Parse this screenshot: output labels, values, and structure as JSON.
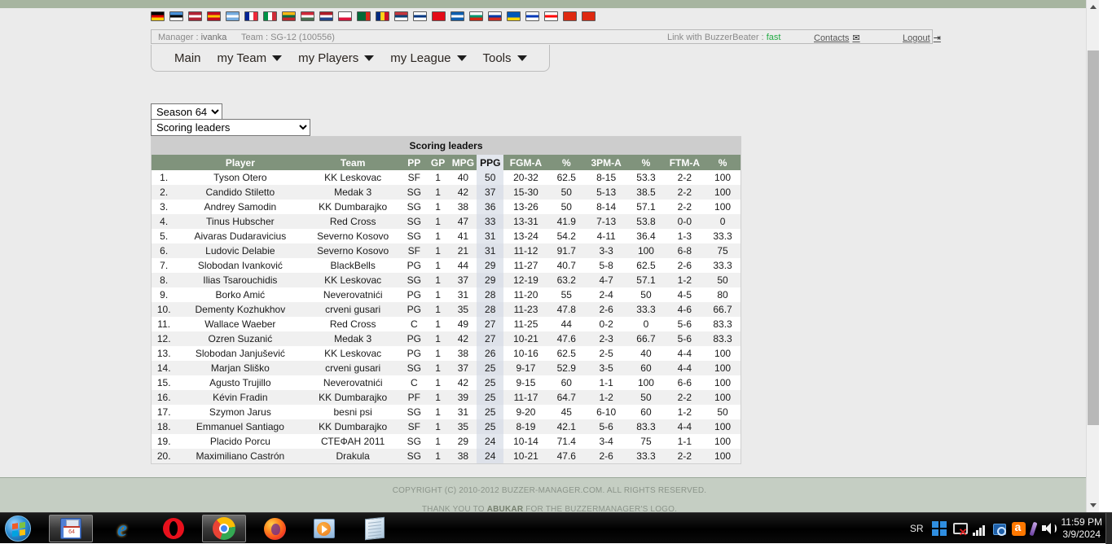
{
  "browser": {
    "scrollbar": {
      "up_arrow": "▲",
      "down_arrow": "▼"
    }
  },
  "header": {
    "flags": [
      {
        "name": "germany",
        "colors": [
          "#000000",
          "#dd0000",
          "#ffce00"
        ],
        "dir": "h"
      },
      {
        "name": "estonia",
        "colors": [
          "#4891d9",
          "#000000",
          "#ffffff"
        ],
        "dir": "h"
      },
      {
        "name": "usa",
        "colors": [
          "#b22234",
          "#ffffff",
          "#b22234"
        ],
        "dir": "h"
      },
      {
        "name": "spain",
        "colors": [
          "#c60b1e",
          "#ffc400",
          "#c60b1e"
        ],
        "dir": "h"
      },
      {
        "name": "argentina",
        "colors": [
          "#74acdf",
          "#ffffff",
          "#74acdf"
        ],
        "dir": "h"
      },
      {
        "name": "france",
        "colors": [
          "#002395",
          "#ffffff",
          "#ed2939"
        ],
        "dir": "v"
      },
      {
        "name": "italy",
        "colors": [
          "#009246",
          "#ffffff",
          "#ce2b37"
        ],
        "dir": "v"
      },
      {
        "name": "lithuania",
        "colors": [
          "#fdb913",
          "#006a44",
          "#c1272d"
        ],
        "dir": "h"
      },
      {
        "name": "hungary",
        "colors": [
          "#ce2939",
          "#ffffff",
          "#477050"
        ],
        "dir": "h"
      },
      {
        "name": "netherlands",
        "colors": [
          "#ae1c28",
          "#ffffff",
          "#21468b"
        ],
        "dir": "h"
      },
      {
        "name": "poland",
        "colors": [
          "#ffffff",
          "#ffffff",
          "#dc143c"
        ],
        "dir": "h"
      },
      {
        "name": "portugal",
        "colors": [
          "#046a38",
          "#046a38",
          "#da291c"
        ],
        "dir": "v"
      },
      {
        "name": "romania",
        "colors": [
          "#002b7f",
          "#fcd116",
          "#ce1126"
        ],
        "dir": "v"
      },
      {
        "name": "serbia",
        "colors": [
          "#c6363c",
          "#0c4076",
          "#ffffff"
        ],
        "dir": "h"
      },
      {
        "name": "finland",
        "colors": [
          "#ffffff",
          "#003580",
          "#ffffff"
        ],
        "dir": "h"
      },
      {
        "name": "turkey",
        "colors": [
          "#e30a17",
          "#e30a17",
          "#e30a17"
        ],
        "dir": "h"
      },
      {
        "name": "greece",
        "colors": [
          "#0d5eaf",
          "#ffffff",
          "#0d5eaf"
        ],
        "dir": "h"
      },
      {
        "name": "bulgaria",
        "colors": [
          "#ffffff",
          "#00966e",
          "#d62612"
        ],
        "dir": "h"
      },
      {
        "name": "russia",
        "colors": [
          "#ffffff",
          "#0039a6",
          "#d52b1e"
        ],
        "dir": "h"
      },
      {
        "name": "ukraine",
        "colors": [
          "#0057b7",
          "#0057b7",
          "#ffd700"
        ],
        "dir": "h"
      },
      {
        "name": "israel",
        "colors": [
          "#ffffff",
          "#0038b8",
          "#ffffff"
        ],
        "dir": "h"
      },
      {
        "name": "georgia",
        "colors": [
          "#ffffff",
          "#ff0000",
          "#ffffff"
        ],
        "dir": "h"
      },
      {
        "name": "china",
        "colors": [
          "#de2910",
          "#de2910",
          "#de2910"
        ],
        "dir": "h"
      },
      {
        "name": "china-2",
        "colors": [
          "#de2910",
          "#de2910",
          "#de2910"
        ],
        "dir": "h"
      }
    ],
    "manager_label": "Manager :",
    "manager_name": "ivanka",
    "team_label": "Team :",
    "team_name": "SG-12 (100556)",
    "bb_link_label": "Link with BuzzerBeater :",
    "bb_link_status": "fast",
    "contacts_label": "Contacts",
    "logout_label": "Logout"
  },
  "menu": {
    "items": [
      {
        "label": "Main",
        "has_caret": false
      },
      {
        "label": "my Team",
        "has_caret": true
      },
      {
        "label": "my Players",
        "has_caret": true
      },
      {
        "label": "my League",
        "has_caret": true
      },
      {
        "label": "Tools",
        "has_caret": true
      }
    ]
  },
  "filters": {
    "season": "Season 64",
    "season_options": [
      "Season 64"
    ],
    "report": "Scoring leaders",
    "report_options": [
      "Scoring leaders"
    ]
  },
  "table": {
    "title": "Scoring leaders",
    "columns": [
      "",
      "Player",
      "Team",
      "PP",
      "GP",
      "MPG",
      "PPG",
      "FGM-A",
      "%",
      "3PM-A",
      "%",
      "FTM-A",
      "%"
    ],
    "highlight_column": "PPG",
    "rows": [
      {
        "rank": "1.",
        "player": "Tyson Otero",
        "team": "KK Leskovac",
        "pp": "SF",
        "gp": "1",
        "mpg": "40",
        "ppg": "50",
        "fgma": "20-32",
        "fgpct": "62.5",
        "tpma": "8-15",
        "tppct": "53.3",
        "ftma": "2-2",
        "ftpct": "100"
      },
      {
        "rank": "2.",
        "player": "Candido Stiletto",
        "team": "Medak 3",
        "pp": "SG",
        "gp": "1",
        "mpg": "42",
        "ppg": "37",
        "fgma": "15-30",
        "fgpct": "50",
        "tpma": "5-13",
        "tppct": "38.5",
        "ftma": "2-2",
        "ftpct": "100"
      },
      {
        "rank": "3.",
        "player": "Andrey Samodin",
        "team": "KK Dumbarajko",
        "pp": "SG",
        "gp": "1",
        "mpg": "38",
        "ppg": "36",
        "fgma": "13-26",
        "fgpct": "50",
        "tpma": "8-14",
        "tppct": "57.1",
        "ftma": "2-2",
        "ftpct": "100"
      },
      {
        "rank": "4.",
        "player": "Tinus Hubscher",
        "team": "Red Cross",
        "pp": "SG",
        "gp": "1",
        "mpg": "47",
        "ppg": "33",
        "fgma": "13-31",
        "fgpct": "41.9",
        "tpma": "7-13",
        "tppct": "53.8",
        "ftma": "0-0",
        "ftpct": "0"
      },
      {
        "rank": "5.",
        "player": "Aivaras Dudaravicius",
        "team": "Severno Kosovo",
        "pp": "SG",
        "gp": "1",
        "mpg": "41",
        "ppg": "31",
        "fgma": "13-24",
        "fgpct": "54.2",
        "tpma": "4-11",
        "tppct": "36.4",
        "ftma": "1-3",
        "ftpct": "33.3"
      },
      {
        "rank": "6.",
        "player": "Ludovic Delabie",
        "team": "Severno Kosovo",
        "pp": "SF",
        "gp": "1",
        "mpg": "21",
        "ppg": "31",
        "fgma": "11-12",
        "fgpct": "91.7",
        "tpma": "3-3",
        "tppct": "100",
        "ftma": "6-8",
        "ftpct": "75"
      },
      {
        "rank": "7.",
        "player": "Slobodan Ivanković",
        "team": "BlackBells",
        "pp": "PG",
        "gp": "1",
        "mpg": "44",
        "ppg": "29",
        "fgma": "11-27",
        "fgpct": "40.7",
        "tpma": "5-8",
        "tppct": "62.5",
        "ftma": "2-6",
        "ftpct": "33.3"
      },
      {
        "rank": "8.",
        "player": "Ilias Tsarouchidis",
        "team": "KK Leskovac",
        "pp": "SG",
        "gp": "1",
        "mpg": "37",
        "ppg": "29",
        "fgma": "12-19",
        "fgpct": "63.2",
        "tpma": "4-7",
        "tppct": "57.1",
        "ftma": "1-2",
        "ftpct": "50"
      },
      {
        "rank": "9.",
        "player": "Borko Amić",
        "team": "Neverovatnići",
        "pp": "PG",
        "gp": "1",
        "mpg": "31",
        "ppg": "28",
        "fgma": "11-20",
        "fgpct": "55",
        "tpma": "2-4",
        "tppct": "50",
        "ftma": "4-5",
        "ftpct": "80"
      },
      {
        "rank": "10.",
        "player": "Dementy Kozhukhov",
        "team": "crveni gusari",
        "pp": "PG",
        "gp": "1",
        "mpg": "35",
        "ppg": "28",
        "fgma": "11-23",
        "fgpct": "47.8",
        "tpma": "2-6",
        "tppct": "33.3",
        "ftma": "4-6",
        "ftpct": "66.7"
      },
      {
        "rank": "11.",
        "player": "Wallace Waeber",
        "team": "Red Cross",
        "pp": "C",
        "gp": "1",
        "mpg": "49",
        "ppg": "27",
        "fgma": "11-25",
        "fgpct": "44",
        "tpma": "0-2",
        "tppct": "0",
        "ftma": "5-6",
        "ftpct": "83.3"
      },
      {
        "rank": "12.",
        "player": "Ozren Suzanić",
        "team": "Medak 3",
        "pp": "PG",
        "gp": "1",
        "mpg": "42",
        "ppg": "27",
        "fgma": "10-21",
        "fgpct": "47.6",
        "tpma": "2-3",
        "tppct": "66.7",
        "ftma": "5-6",
        "ftpct": "83.3"
      },
      {
        "rank": "13.",
        "player": "Slobodan Janjušević",
        "team": "KK Leskovac",
        "pp": "PG",
        "gp": "1",
        "mpg": "38",
        "ppg": "26",
        "fgma": "10-16",
        "fgpct": "62.5",
        "tpma": "2-5",
        "tppct": "40",
        "ftma": "4-4",
        "ftpct": "100"
      },
      {
        "rank": "14.",
        "player": "Marjan Sliško",
        "team": "crveni gusari",
        "pp": "SG",
        "gp": "1",
        "mpg": "37",
        "ppg": "25",
        "fgma": "9-17",
        "fgpct": "52.9",
        "tpma": "3-5",
        "tppct": "60",
        "ftma": "4-4",
        "ftpct": "100"
      },
      {
        "rank": "15.",
        "player": "Agusto Trujillo",
        "team": "Neverovatnići",
        "pp": "C",
        "gp": "1",
        "mpg": "42",
        "ppg": "25",
        "fgma": "9-15",
        "fgpct": "60",
        "tpma": "1-1",
        "tppct": "100",
        "ftma": "6-6",
        "ftpct": "100"
      },
      {
        "rank": "16.",
        "player": "Kévin Fradin",
        "team": "KK Dumbarajko",
        "pp": "PF",
        "gp": "1",
        "mpg": "39",
        "ppg": "25",
        "fgma": "11-17",
        "fgpct": "64.7",
        "tpma": "1-2",
        "tppct": "50",
        "ftma": "2-2",
        "ftpct": "100"
      },
      {
        "rank": "17.",
        "player": "Szymon Jarus",
        "team": "besni psi",
        "pp": "SG",
        "gp": "1",
        "mpg": "31",
        "ppg": "25",
        "fgma": "9-20",
        "fgpct": "45",
        "tpma": "6-10",
        "tppct": "60",
        "ftma": "1-2",
        "ftpct": "50"
      },
      {
        "rank": "18.",
        "player": "Emmanuel Santiago",
        "team": "KK Dumbarajko",
        "pp": "SF",
        "gp": "1",
        "mpg": "35",
        "ppg": "25",
        "fgma": "8-19",
        "fgpct": "42.1",
        "tpma": "5-6",
        "tppct": "83.3",
        "ftma": "4-4",
        "ftpct": "100"
      },
      {
        "rank": "19.",
        "player": "Placido Porcu",
        "team": "СТЕФАН 2011",
        "pp": "SG",
        "gp": "1",
        "mpg": "29",
        "ppg": "24",
        "fgma": "10-14",
        "fgpct": "71.4",
        "tpma": "3-4",
        "tppct": "75",
        "ftma": "1-1",
        "ftpct": "100"
      },
      {
        "rank": "20.",
        "player": "Maximiliano Castrón",
        "team": "Drakula",
        "pp": "SG",
        "gp": "1",
        "mpg": "38",
        "ppg": "24",
        "fgma": "10-21",
        "fgpct": "47.6",
        "tpma": "2-6",
        "tppct": "33.3",
        "ftma": "2-2",
        "ftpct": "100"
      }
    ]
  },
  "footer": {
    "line1": "COPYRIGHT (C) 2010-2012 BUZZER-MANAGER.COM. ALL RIGHTS RESERVED.",
    "line2_pre": "THANK YOU TO ",
    "line2_name": "ABUKAR",
    "line2_post": " FOR THE BUZZERMANAGER'S LOGO."
  },
  "taskbar": {
    "buttons": [
      {
        "name": "floppy-64",
        "icon": "floppy-icon",
        "active": true
      },
      {
        "name": "internet-explorer",
        "icon": "internet-explorer-icon",
        "active": false
      },
      {
        "name": "opera",
        "icon": "opera-icon",
        "active": false
      },
      {
        "name": "google-chrome",
        "icon": "chrome-icon",
        "active": true
      },
      {
        "name": "firefox",
        "icon": "firefox-icon",
        "active": false
      },
      {
        "name": "windows-media-player",
        "icon": "media-player-icon",
        "active": false
      },
      {
        "name": "notepad",
        "icon": "notepad-icon",
        "active": false
      }
    ],
    "language": "SR",
    "time": "11:59 PM",
    "date": "3/9/2024"
  }
}
